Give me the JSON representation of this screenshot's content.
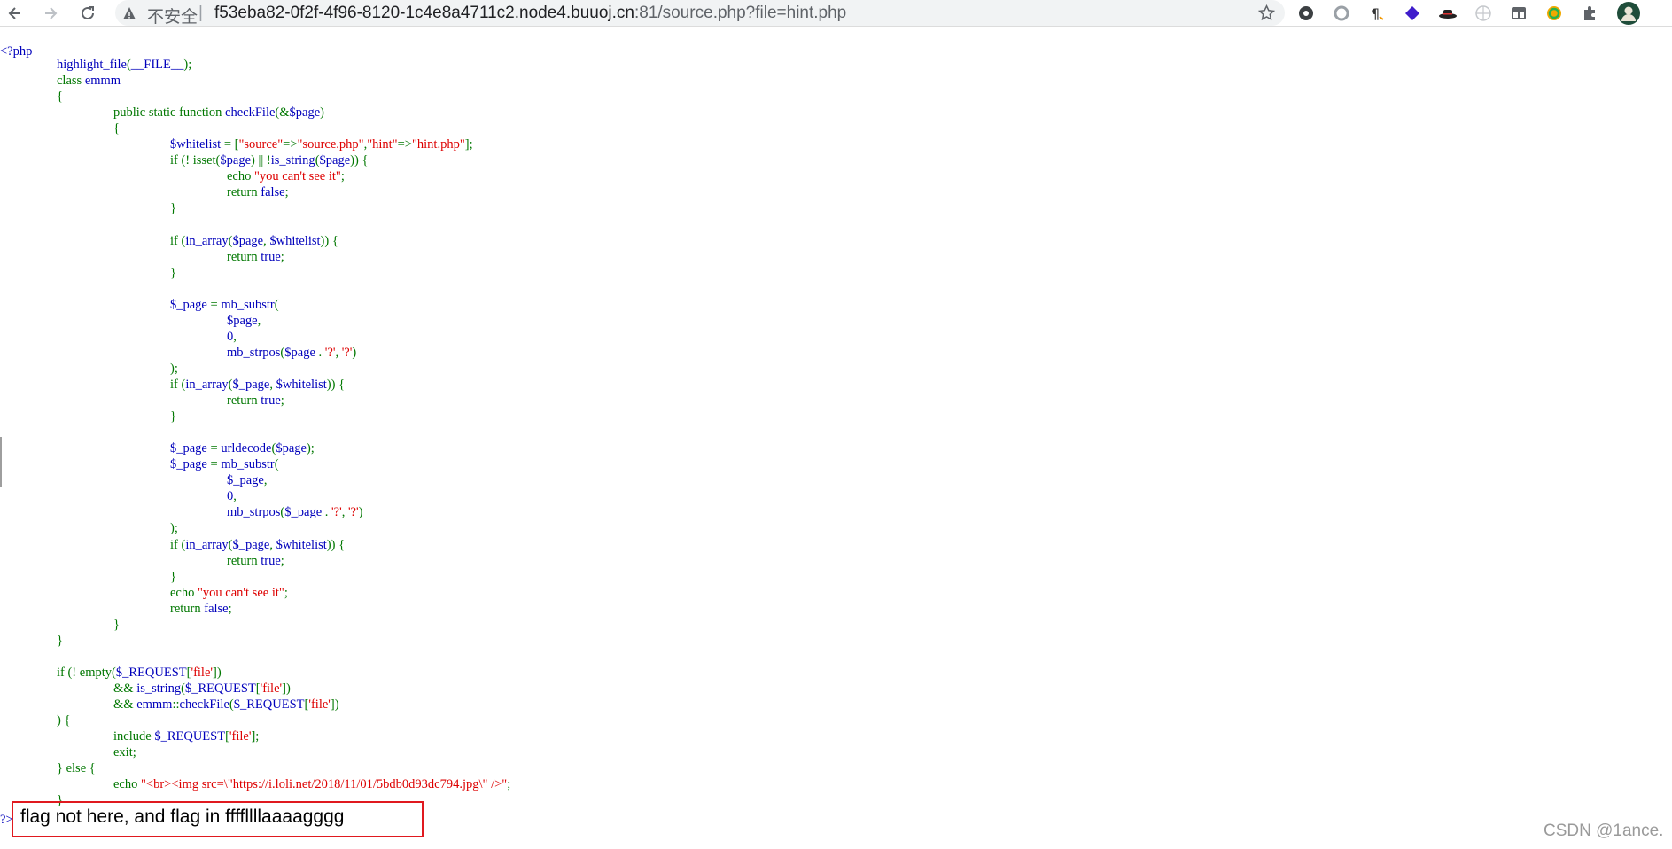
{
  "browser": {
    "insecure_label": "不安全",
    "separator": "|",
    "url_host": "f53eba82-0f2f-4f96-8120-1c4e8a4711c2.node4.buuoj.cn",
    "url_rest": ":81/source.php?file=hint.php",
    "icons": [
      "back-icon",
      "forward-icon",
      "reload-icon",
      "warning-icon",
      "star-icon",
      "gear-extension-icon",
      "circle-extension-icon",
      "paragraph-extension-icon",
      "layers-extension-icon",
      "hat-extension-icon",
      "globe-extension-icon",
      "grid-extension-icon",
      "refresh-extension-icon",
      "puzzle-icon",
      "profile-avatar"
    ]
  },
  "source": {
    "open_tag": "<?php",
    "lines": [
      [
        {
          "t": "highlight_file",
          "c": "b"
        },
        {
          "t": "(",
          "c": "g"
        },
        {
          "t": "__FILE__",
          "c": "b"
        },
        {
          "t": ");",
          "c": "g"
        }
      ],
      [
        {
          "t": "class ",
          "c": "g"
        },
        {
          "t": "emmm",
          "c": "b"
        }
      ],
      [
        {
          "t": "{",
          "c": "g"
        }
      ],
      [
        {
          "t": "public static function ",
          "c": "g"
        },
        {
          "t": "checkFile",
          "c": "b"
        },
        {
          "t": "(&",
          "c": "g"
        },
        {
          "t": "$page",
          "c": "b"
        },
        {
          "t": ")",
          "c": "g"
        }
      ],
      [
        {
          "t": "{",
          "c": "g"
        }
      ],
      [
        {
          "t": "$whitelist ",
          "c": "b"
        },
        {
          "t": "= [",
          "c": "g"
        },
        {
          "t": "\"source\"",
          "c": "r"
        },
        {
          "t": "=>",
          "c": "g"
        },
        {
          "t": "\"source.php\"",
          "c": "r"
        },
        {
          "t": ",",
          "c": "g"
        },
        {
          "t": "\"hint\"",
          "c": "r"
        },
        {
          "t": "=>",
          "c": "g"
        },
        {
          "t": "\"hint.php\"",
          "c": "r"
        },
        {
          "t": "];",
          "c": "g"
        }
      ],
      [
        {
          "t": "if (! ",
          "c": "g"
        },
        {
          "t": "isset",
          "c": "g"
        },
        {
          "t": "(",
          "c": "g"
        },
        {
          "t": "$page",
          "c": "b"
        },
        {
          "t": ") || !",
          "c": "g"
        },
        {
          "t": "is_string",
          "c": "b"
        },
        {
          "t": "(",
          "c": "g"
        },
        {
          "t": "$page",
          "c": "b"
        },
        {
          "t": ")) {",
          "c": "g"
        }
      ],
      [
        {
          "t": "echo ",
          "c": "g"
        },
        {
          "t": "\"you can't see it\"",
          "c": "r"
        },
        {
          "t": ";",
          "c": "g"
        }
      ],
      [
        {
          "t": "return ",
          "c": "g"
        },
        {
          "t": "false",
          "c": "b"
        },
        {
          "t": ";",
          "c": "g"
        }
      ],
      [
        {
          "t": "}",
          "c": "g"
        }
      ],
      [],
      [
        {
          "t": "if (",
          "c": "g"
        },
        {
          "t": "in_array",
          "c": "b"
        },
        {
          "t": "(",
          "c": "g"
        },
        {
          "t": "$page",
          "c": "b"
        },
        {
          "t": ", ",
          "c": "g"
        },
        {
          "t": "$whitelist",
          "c": "b"
        },
        {
          "t": ")) {",
          "c": "g"
        }
      ],
      [
        {
          "t": "return ",
          "c": "g"
        },
        {
          "t": "true",
          "c": "b"
        },
        {
          "t": ";",
          "c": "g"
        }
      ],
      [
        {
          "t": "}",
          "c": "g"
        }
      ],
      [],
      [
        {
          "t": "$_page ",
          "c": "b"
        },
        {
          "t": "= ",
          "c": "g"
        },
        {
          "t": "mb_substr",
          "c": "b"
        },
        {
          "t": "(",
          "c": "g"
        }
      ],
      [
        {
          "t": "$page",
          "c": "b"
        },
        {
          "t": ",",
          "c": "g"
        }
      ],
      [
        {
          "t": "0",
          "c": "b"
        },
        {
          "t": ",",
          "c": "g"
        }
      ],
      [
        {
          "t": "mb_strpos",
          "c": "b"
        },
        {
          "t": "(",
          "c": "g"
        },
        {
          "t": "$page ",
          "c": "b"
        },
        {
          "t": ". ",
          "c": "g"
        },
        {
          "t": "'?'",
          "c": "r"
        },
        {
          "t": ", ",
          "c": "g"
        },
        {
          "t": "'?'",
          "c": "r"
        },
        {
          "t": ")",
          "c": "g"
        }
      ],
      [
        {
          "t": ");",
          "c": "g"
        }
      ],
      [
        {
          "t": "if (",
          "c": "g"
        },
        {
          "t": "in_array",
          "c": "b"
        },
        {
          "t": "(",
          "c": "g"
        },
        {
          "t": "$_page",
          "c": "b"
        },
        {
          "t": ", ",
          "c": "g"
        },
        {
          "t": "$whitelist",
          "c": "b"
        },
        {
          "t": ")) {",
          "c": "g"
        }
      ],
      [
        {
          "t": "return ",
          "c": "g"
        },
        {
          "t": "true",
          "c": "b"
        },
        {
          "t": ";",
          "c": "g"
        }
      ],
      [
        {
          "t": "}",
          "c": "g"
        }
      ],
      [],
      [
        {
          "t": "$_page ",
          "c": "b"
        },
        {
          "t": "= ",
          "c": "g"
        },
        {
          "t": "urldecode",
          "c": "b"
        },
        {
          "t": "(",
          "c": "g"
        },
        {
          "t": "$page",
          "c": "b"
        },
        {
          "t": ");",
          "c": "g"
        }
      ],
      [
        {
          "t": "$_page ",
          "c": "b"
        },
        {
          "t": "= ",
          "c": "g"
        },
        {
          "t": "mb_substr",
          "c": "b"
        },
        {
          "t": "(",
          "c": "g"
        }
      ],
      [
        {
          "t": "$_page",
          "c": "b"
        },
        {
          "t": ",",
          "c": "g"
        }
      ],
      [
        {
          "t": "0",
          "c": "b"
        },
        {
          "t": ",",
          "c": "g"
        }
      ],
      [
        {
          "t": "mb_strpos",
          "c": "b"
        },
        {
          "t": "(",
          "c": "g"
        },
        {
          "t": "$_page ",
          "c": "b"
        },
        {
          "t": ". ",
          "c": "g"
        },
        {
          "t": "'?'",
          "c": "r"
        },
        {
          "t": ", ",
          "c": "g"
        },
        {
          "t": "'?'",
          "c": "r"
        },
        {
          "t": ")",
          "c": "g"
        }
      ],
      [
        {
          "t": ");",
          "c": "g"
        }
      ],
      [
        {
          "t": "if (",
          "c": "g"
        },
        {
          "t": "in_array",
          "c": "b"
        },
        {
          "t": "(",
          "c": "g"
        },
        {
          "t": "$_page",
          "c": "b"
        },
        {
          "t": ", ",
          "c": "g"
        },
        {
          "t": "$whitelist",
          "c": "b"
        },
        {
          "t": ")) {",
          "c": "g"
        }
      ],
      [
        {
          "t": "return ",
          "c": "g"
        },
        {
          "t": "true",
          "c": "b"
        },
        {
          "t": ";",
          "c": "g"
        }
      ],
      [
        {
          "t": "}",
          "c": "g"
        }
      ],
      [
        {
          "t": "echo ",
          "c": "g"
        },
        {
          "t": "\"you can't see it\"",
          "c": "r"
        },
        {
          "t": ";",
          "c": "g"
        }
      ],
      [
        {
          "t": "return ",
          "c": "g"
        },
        {
          "t": "false",
          "c": "b"
        },
        {
          "t": ";",
          "c": "g"
        }
      ],
      [
        {
          "t": "}",
          "c": "g"
        }
      ],
      [
        {
          "t": "}",
          "c": "g"
        }
      ],
      [],
      [
        {
          "t": "if (! ",
          "c": "g"
        },
        {
          "t": "empty",
          "c": "g"
        },
        {
          "t": "(",
          "c": "g"
        },
        {
          "t": "$_REQUEST",
          "c": "b"
        },
        {
          "t": "[",
          "c": "g"
        },
        {
          "t": "'file'",
          "c": "r"
        },
        {
          "t": "])",
          "c": "g"
        }
      ],
      [
        {
          "t": "&& ",
          "c": "g"
        },
        {
          "t": "is_string",
          "c": "b"
        },
        {
          "t": "(",
          "c": "g"
        },
        {
          "t": "$_REQUEST",
          "c": "b"
        },
        {
          "t": "[",
          "c": "g"
        },
        {
          "t": "'file'",
          "c": "r"
        },
        {
          "t": "])",
          "c": "g"
        }
      ],
      [
        {
          "t": "&& ",
          "c": "g"
        },
        {
          "t": "emmm",
          "c": "b"
        },
        {
          "t": "::",
          "c": "g"
        },
        {
          "t": "checkFile",
          "c": "b"
        },
        {
          "t": "(",
          "c": "g"
        },
        {
          "t": "$_REQUEST",
          "c": "b"
        },
        {
          "t": "[",
          "c": "g"
        },
        {
          "t": "'file'",
          "c": "r"
        },
        {
          "t": "])",
          "c": "g"
        }
      ],
      [
        {
          "t": ") {",
          "c": "g"
        }
      ],
      [
        {
          "t": "include ",
          "c": "g"
        },
        {
          "t": "$_REQUEST",
          "c": "b"
        },
        {
          "t": "[",
          "c": "g"
        },
        {
          "t": "'file'",
          "c": "r"
        },
        {
          "t": "];",
          "c": "g"
        }
      ],
      [
        {
          "t": "exit",
          "c": "g"
        },
        {
          "t": ";",
          "c": "g"
        }
      ],
      [
        {
          "t": "} else {",
          "c": "g"
        }
      ],
      [
        {
          "t": "echo ",
          "c": "g"
        },
        {
          "t": "\"<br><img src=\\\"https://i.loli.net/2018/11/01/5bdb0d93dc794.jpg\\\" />\"",
          "c": "r"
        },
        {
          "t": ";",
          "c": "g"
        }
      ],
      [
        {
          "t": "}",
          "c": "g"
        }
      ]
    ],
    "close_tag": "?>",
    "output_text": "flag not here, and flag in ffffllllaaaagggg"
  },
  "watermark": "CSDN @1ance."
}
